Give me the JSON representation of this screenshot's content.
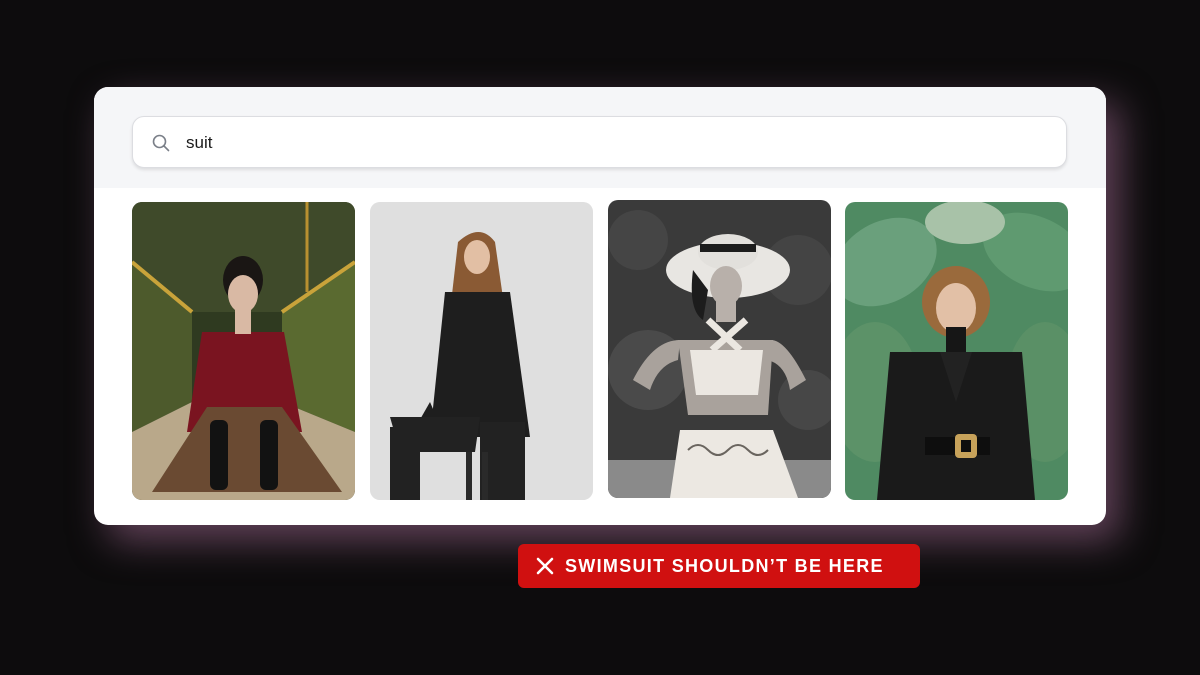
{
  "search": {
    "icon": "search-icon",
    "value": "suit"
  },
  "results": [
    {
      "subject": "woman in burgundy blazer and plaid trousers in a gold room"
    },
    {
      "subject": "woman in black suit seated on a stool"
    },
    {
      "subject": "woman in sun hat and patterned halter swimsuit, black and white"
    },
    {
      "subject": "woman in black belted blazer among banana leaves"
    }
  ],
  "warning": {
    "icon": "close-icon",
    "label": "SWIMSUIT SHOULDN’T BE HERE",
    "color": "#d01010"
  },
  "colors": {
    "background": "#0d0c0d",
    "card": "#ffffff",
    "glow": "#a56e96"
  }
}
